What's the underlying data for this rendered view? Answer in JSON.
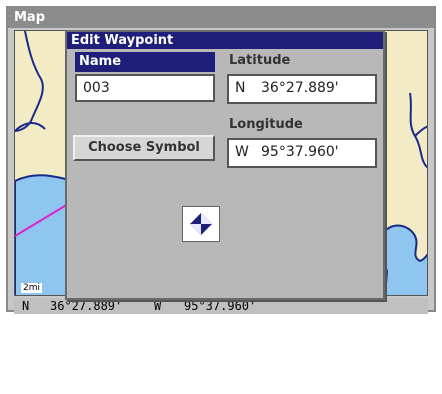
{
  "window": {
    "title": "Map"
  },
  "map": {
    "scale": "2mi"
  },
  "status": {
    "lat_hemi": "N",
    "lat": "36°27.889'",
    "lon_hemi": "W",
    "lon": "95°37.960'"
  },
  "dialog": {
    "title": "Edit Waypoint",
    "name_label": "Name",
    "name_value": "003",
    "latitude_label": "Latitude",
    "latitude_hemi": "N",
    "latitude_value": "36°27.889'",
    "longitude_label": "Longitude",
    "longitude_hemi": "W",
    "longitude_value": "95°37.960'",
    "choose_symbol_label": "Choose Symbol",
    "symbol_icon": "waypoint-diamond-icon"
  },
  "colors": {
    "land": "#f3ebc5",
    "water": "#8fc6ef",
    "shoreline": "#1a2a8a",
    "route": "#e020c8",
    "selection": "#1f1f7a"
  }
}
